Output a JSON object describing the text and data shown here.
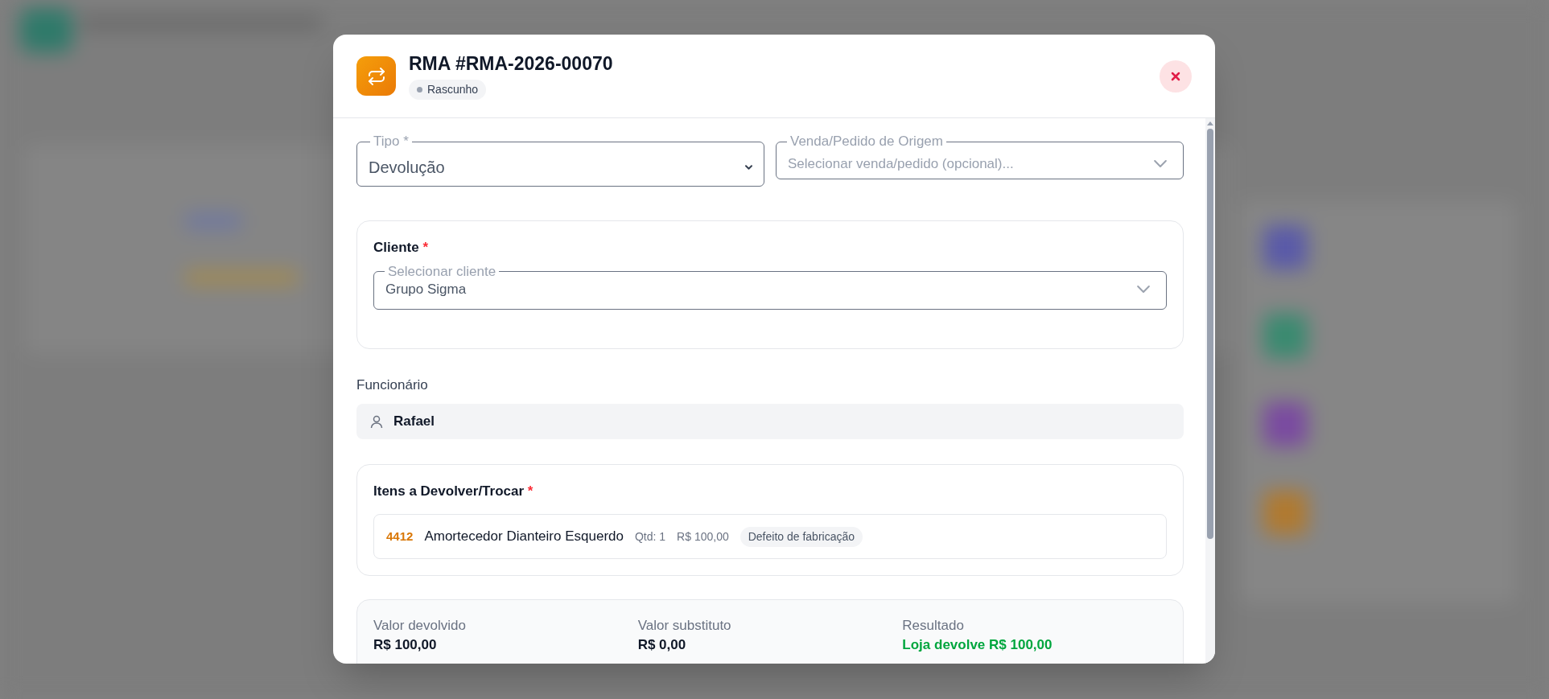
{
  "dialog": {
    "title": "RMA #RMA-2026-00070",
    "status": "Rascunho"
  },
  "fields": [
    {
      "kind": "native",
      "label": "Tipo *",
      "value": "Devolução"
    },
    {
      "kind": "custom",
      "label": "Venda/Pedido de Origem",
      "placeholder": "Selecionar venda/pedido (opcional)..."
    }
  ],
  "client": {
    "title": "Cliente",
    "required_mark": "*",
    "field": {
      "label": "Selecionar cliente",
      "value": "Grupo Sigma"
    }
  },
  "employee": {
    "label": "Funcionário",
    "value": "Rafael"
  },
  "items": {
    "title": "Itens a Devolver/Trocar",
    "required_mark": "*",
    "rows": [
      {
        "code": "4412",
        "name": "Amortecedor Dianteiro Esquerdo",
        "qty": "Qtd: 1",
        "price": "R$ 100,00",
        "reason": "Defeito de fabricação"
      }
    ]
  },
  "summary": [
    {
      "kind": "neutral",
      "label": "Valor devolvido",
      "value": "R$ 100,00"
    },
    {
      "kind": "neutral",
      "label": "Valor substituto",
      "value": "R$ 0,00"
    },
    {
      "kind": "positive",
      "label": "Resultado",
      "value": "Loja devolve R$ 100,00"
    }
  ]
}
